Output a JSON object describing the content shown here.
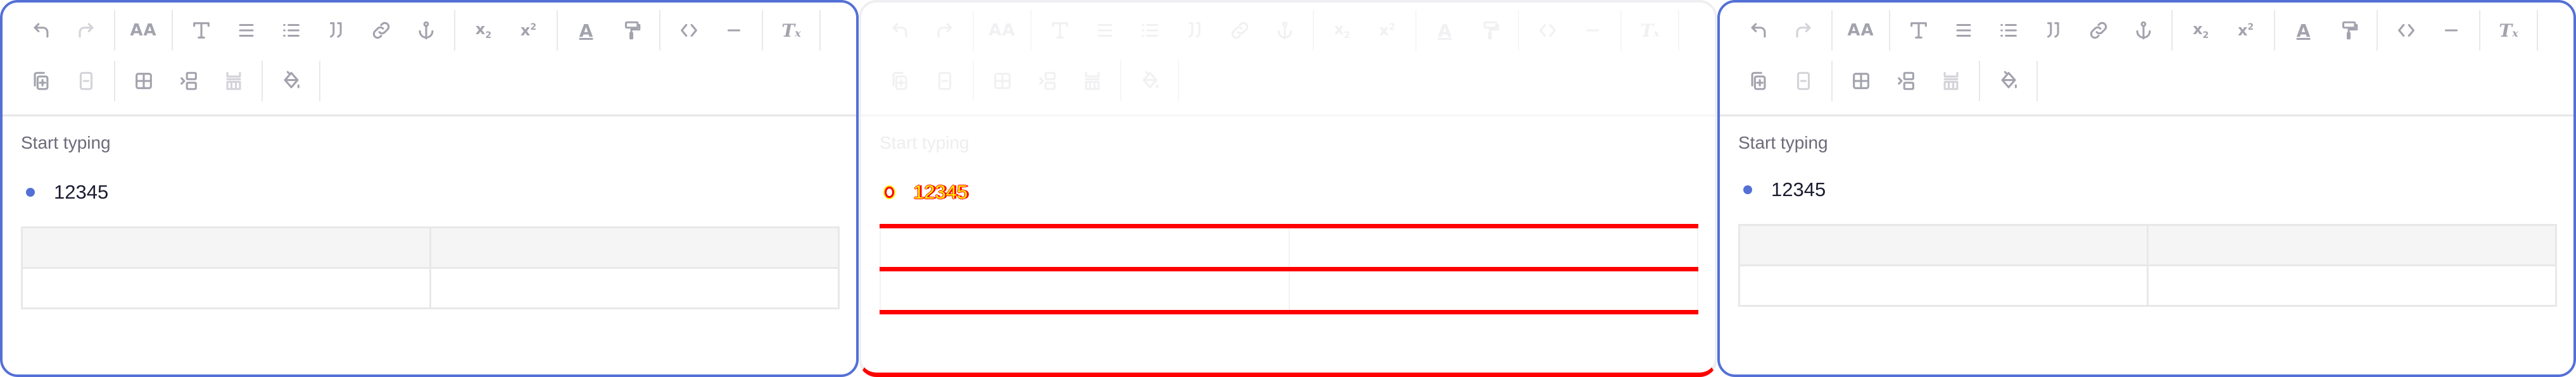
{
  "editor": {
    "placeholder": "Start typing",
    "list_items": [
      "12345"
    ],
    "table": {
      "rows": [
        [
          "",
          ""
        ],
        [
          "",
          ""
        ]
      ],
      "header_row": true
    }
  },
  "panels": [
    {
      "name": "editor-left",
      "state": "focused"
    },
    {
      "name": "editor-diff",
      "state": "diff-overlay"
    },
    {
      "name": "editor-right",
      "state": "focused"
    }
  ],
  "toolbar": {
    "rows": [
      [
        [
          "undo",
          "redo"
        ],
        [
          "font-size"
        ],
        [
          "heading",
          "align",
          "bullet-list",
          "blockquote",
          "link",
          "anchor"
        ],
        [
          "subscript",
          "superscript"
        ],
        [
          "text-color",
          "format-painter"
        ],
        [
          "code",
          "horizontal-rule"
        ],
        [
          "clear-format"
        ]
      ],
      [
        [
          "add-row",
          "delete-row"
        ],
        [
          "insert-table",
          "merge-cells",
          "split-cells"
        ],
        [
          "cell-background"
        ]
      ]
    ],
    "disabled": [
      "redo",
      "delete-row",
      "split-cells"
    ]
  },
  "colors": {
    "accent": "#5470d6",
    "icon": "#a3a3ae",
    "icon_disabled": "#d3d3d9",
    "diff": "#ff0000",
    "diff_secondary": "#ffee00"
  }
}
